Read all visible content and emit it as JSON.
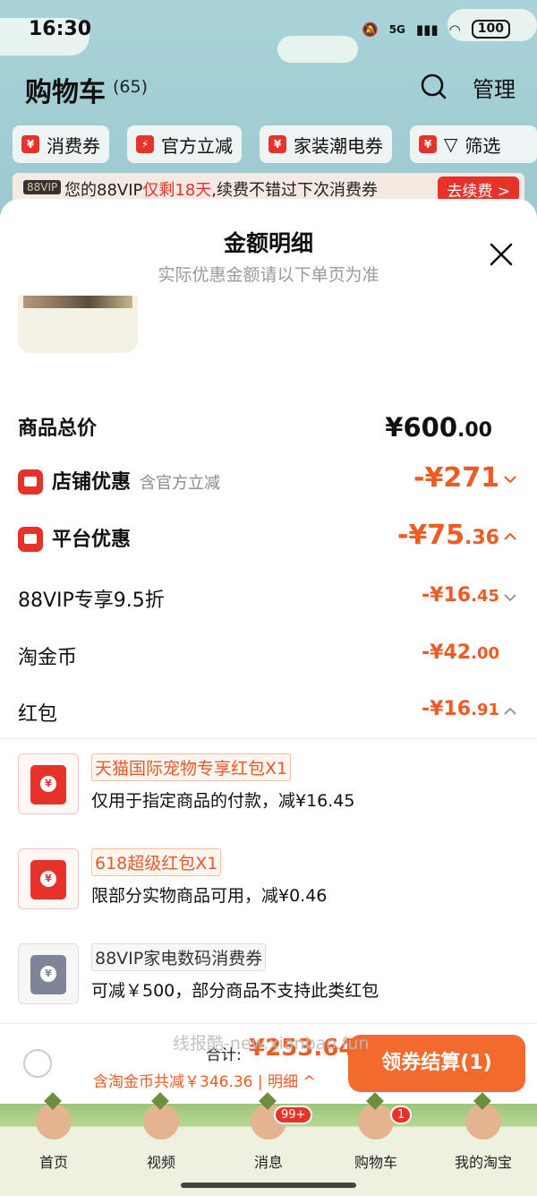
{
  "status": {
    "time": "16:30",
    "network": "5G",
    "battery": "100"
  },
  "header": {
    "title": "购物车",
    "count": "(65)",
    "manage": "管理"
  },
  "filters": [
    "消费券",
    "官方立减",
    "家装潮电券",
    "筛选"
  ],
  "vip_banner": {
    "tag": "88VIP",
    "text_before": "您的88VIP",
    "highlight": "仅剩18天",
    "text_after": ",续费不错过下次消费券",
    "button": "去续费 >"
  },
  "sheet": {
    "title": "金额明细",
    "subtitle": "实际优惠金额请以下单页为准",
    "total_label": "商品总价",
    "total_main": "¥600",
    "total_dec": ".00",
    "store_label": "店铺优惠",
    "store_note": "含官方立减",
    "store_amount": "-¥271",
    "platform_label": "平台优惠",
    "platform_main": "-¥75",
    "platform_dec": ".36",
    "vip_label": "88VIP专享9.5折",
    "vip_main": "-¥16",
    "vip_dec": ".45",
    "coin_label": "淘金币",
    "coin_main": "-¥42",
    "coin_dec": ".00",
    "redpacket_label": "红包",
    "redpacket_main": "-¥16",
    "redpacket_dec": ".91"
  },
  "packets": [
    {
      "name": "天猫国际宠物专享红包X1",
      "desc": "仅用于指定商品的付款，减¥16.45",
      "icon": "red-envelope-icon"
    },
    {
      "name": "618超级红包X1",
      "desc": "限部分实物商品可用，减¥0.46",
      "icon": "red-envelope-icon"
    },
    {
      "name": "88VIP家电数码消费券",
      "desc": "可减￥500，部分商品不支持此类红包",
      "icon": "grey-envelope-icon"
    }
  ],
  "checkout": {
    "sum_label": "合计:",
    "sum_value": "¥253.64",
    "savings": "含淘金币共减￥346.36 | 明细 ^",
    "button": "领券结算(1)"
  },
  "watermark": "线报酷-new.xianbao.fun",
  "tabs": [
    {
      "label": "首页"
    },
    {
      "label": "视频"
    },
    {
      "label": "消息",
      "badge": "99+"
    },
    {
      "label": "购物车",
      "badge": "1"
    },
    {
      "label": "我的淘宝"
    }
  ],
  "colors": {
    "accent": "#f05a23",
    "red": "#e6332a",
    "checkout_button": "#f26a2d"
  }
}
